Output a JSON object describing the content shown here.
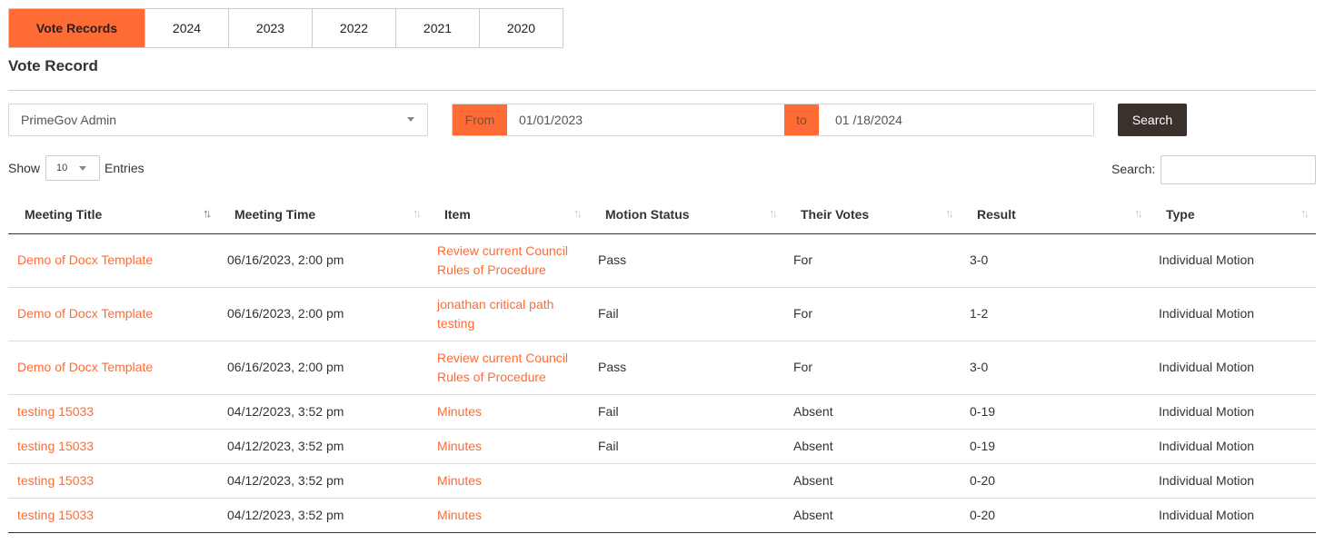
{
  "tabs": [
    {
      "label": "Vote Records",
      "active": true
    },
    {
      "label": "2024",
      "active": false
    },
    {
      "label": "2023",
      "active": false
    },
    {
      "label": "2022",
      "active": false
    },
    {
      "label": "2021",
      "active": false
    },
    {
      "label": "2020",
      "active": false
    }
  ],
  "page_title": "Vote Record",
  "filters": {
    "member_select": "PrimeGov Admin",
    "from_label": "From",
    "from_date": "01/01/2023",
    "to_label": "to",
    "to_date": "01 /18/2024",
    "search_button": "Search"
  },
  "table_controls": {
    "show_label": "Show",
    "entries_value": "10",
    "entries_label": "Entries",
    "search_label": "Search:"
  },
  "table": {
    "headers": [
      "Meeting Title",
      "Meeting Time",
      "Item",
      "Motion Status",
      "Their Votes",
      "Result",
      "Type"
    ],
    "rows": [
      [
        "Demo of Docx Template",
        "06/16/2023, 2:00 pm",
        "Review current Council Rules of Procedure",
        "Pass",
        "For",
        "3-0",
        "Individual Motion"
      ],
      [
        "Demo of Docx Template",
        "06/16/2023, 2:00 pm",
        "jonathan critical path testing",
        "Fail",
        "For",
        "1-2",
        "Individual Motion"
      ],
      [
        "Demo of Docx Template",
        "06/16/2023, 2:00 pm",
        "Review current Council Rules of Procedure",
        "Pass",
        "For",
        "3-0",
        "Individual Motion"
      ],
      [
        "testing 15033",
        "04/12/2023, 3:52 pm",
        "Minutes",
        "Fail",
        "Absent",
        "0-19",
        "Individual Motion"
      ],
      [
        "testing 15033",
        "04/12/2023, 3:52 pm",
        "Minutes",
        "Fail",
        "Absent",
        "0-19",
        "Individual Motion"
      ],
      [
        "testing 15033",
        "04/12/2023, 3:52 pm",
        "Minutes",
        "",
        "Absent",
        "0-20",
        "Individual Motion"
      ],
      [
        "testing 15033",
        "04/12/2023, 3:52 pm",
        "Minutes",
        "",
        "Absent",
        "0-20",
        "Individual Motion"
      ]
    ]
  },
  "colors": {
    "accent": "#ff6b35",
    "dark_button": "#3a302c"
  }
}
